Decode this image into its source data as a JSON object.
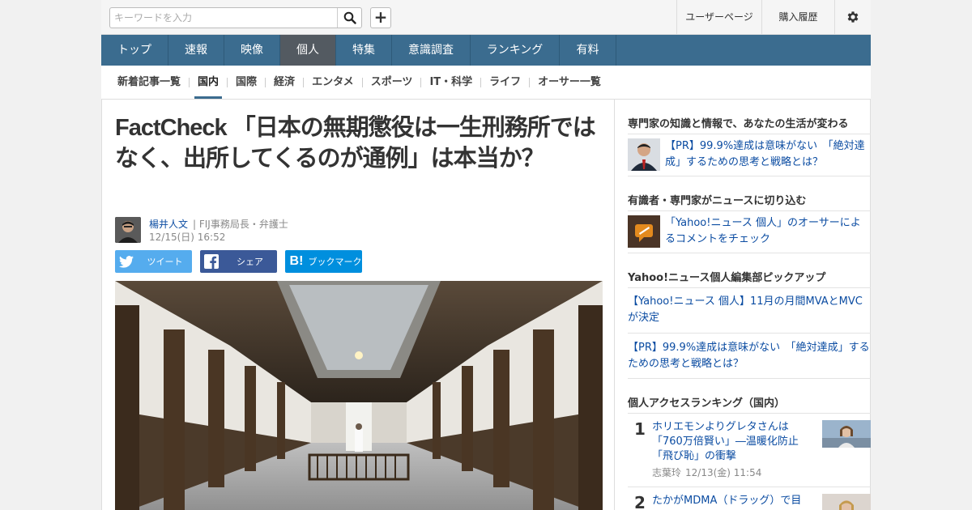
{
  "header": {
    "search_placeholder": "キーワードを入力",
    "user_page": "ユーザーページ",
    "purchase_history": "購入履歴"
  },
  "main_nav": [
    {
      "label": "トップ",
      "active": false
    },
    {
      "label": "速報",
      "active": false
    },
    {
      "label": "映像",
      "active": false
    },
    {
      "label": "個人",
      "active": true
    },
    {
      "label": "特集",
      "active": false
    },
    {
      "label": "意識調査",
      "active": false
    },
    {
      "label": "ランキング",
      "active": false
    },
    {
      "label": "有料",
      "active": false
    }
  ],
  "sub_nav": [
    {
      "label": "新着記事一覧",
      "active": false
    },
    {
      "label": "国内",
      "active": true
    },
    {
      "label": "国際",
      "active": false
    },
    {
      "label": "経済",
      "active": false
    },
    {
      "label": "エンタメ",
      "active": false
    },
    {
      "label": "スポーツ",
      "active": false
    },
    {
      "label": "IT・科学",
      "active": false
    },
    {
      "label": "ライフ",
      "active": false
    },
    {
      "label": "オーサー一覧",
      "active": false
    }
  ],
  "article": {
    "title": "FactCheck 「日本の無期懲役は一生刑務所ではなく、出所してくるのが通例」は本当か？",
    "author_name": "楊井人文",
    "author_role": "| FIJ事務局長・弁護士",
    "date": "12/15(日) 16:52",
    "share": {
      "twitter": "ツイート",
      "facebook": "シェア",
      "hatena": "ブックマーク"
    }
  },
  "sidebar": {
    "section1": {
      "heading": "専門家の知識と情報で、あなたの生活が変わる",
      "link": "【PR】99.9%達成は意味がない　「絶対達成」するための思考と戦略とは？"
    },
    "section2": {
      "heading": "有識者・専門家がニュースに切り込む",
      "link": "「Yahoo!ニュース 個人」のオーサーによるコメントをチェック"
    },
    "section3": {
      "heading": "Yahoo!ニュース個人編集部ピックアップ",
      "links": [
        "【Yahoo!ニュース 個人】11月の月間MVAとMVCが決定",
        "【PR】99.9%達成は意味がない　「絶対達成」するための思考と戦略とは？"
      ]
    },
    "ranking": {
      "heading": "個人アクセスランキング（国内）",
      "items": [
        {
          "rank": "1",
          "title": "ホリエモンよりグレタさんは「760万倍賢い」―温暖化防止「飛び恥」の衝撃",
          "author": "志葉玲",
          "date": "12/13(金) 11:54"
        },
        {
          "rank": "2",
          "title": "たかがMDMA（ドラッグ）で目"
        }
      ]
    }
  },
  "colors": {
    "nav_bg": "#3b6c8f",
    "nav_active": "#535a61",
    "link": "#0b4ca2",
    "twitter": "#55acee",
    "facebook": "#3b5998",
    "hatena": "#008fde"
  }
}
